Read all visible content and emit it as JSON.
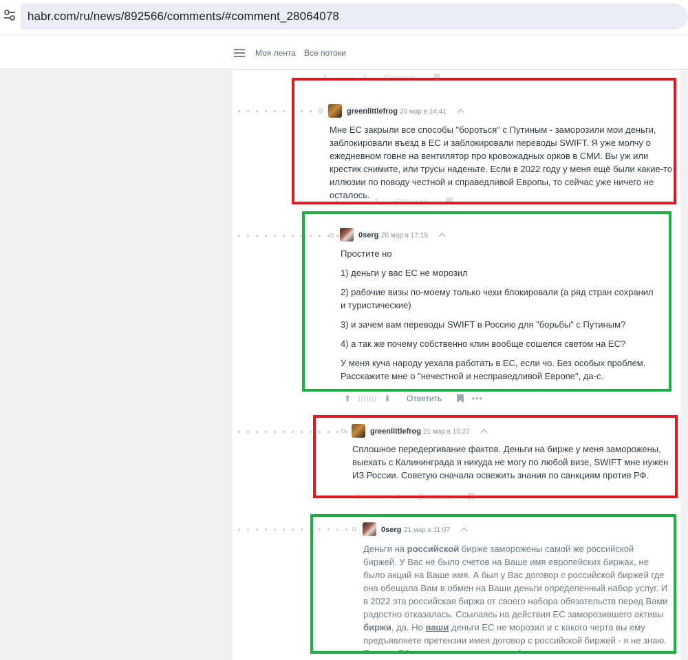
{
  "browser": {
    "url": "habr.com/ru/news/892566/comments/#comment_28064078"
  },
  "header": {
    "my_feed": "Моя лента",
    "all_streams": "Все потоки"
  },
  "actions": {
    "reply": "Ответить",
    "more": "•••"
  },
  "comments": [
    {
      "author": "greenlittlefrog",
      "date": "20 мар в 14:41",
      "paragraphs": [
        "Мне ЕС закрыли все способы \"бороться\" с Путиным - заморозили мои деньги, заблокировали въезд в ЕС и заблокировали переводы SWIFT. Я уже молчу о ежедневном говне на вентилятор про кровожадных орков в СМИ. Вы уж или крестик снимите, или трусы наденьте. Если в 2022 году у меня ещё были какие-то иллюзии по поводу честной и справедливой Европы, то сейчас уже ничего не осталось."
      ],
      "highlight": "#e11a22"
    },
    {
      "author": "0serg",
      "date": "20 мар в 17:19",
      "paragraphs": [
        "Простите но",
        "1) деньги у вас ЕС не морозил",
        "2) рабочие визы по-моему только чехи блокировали (а ряд стран сохранил и туристические)",
        "3) и зачем вам переводы SWIFT в Россию для \"борьбы\" с Путиным?",
        "4) а так же почему собственно клин вообще сошелся светом на ЕС?",
        "У меня куча народу уехала работать в ЕС, если чо. Без особых проблем. Расскажите мне о \"нечестной и несправедливой Европе\", да-с."
      ],
      "highlight": "#1cb043"
    },
    {
      "author": "greenlittlefrog",
      "date": "21 мар в 10:27",
      "paragraphs": [
        "Сплошное передергивание фактов. Деньги на бирже у меня заморожены, выехать с Калининграда я никуда не могу по любой визе, SWIFT мне нужен ИЗ России. Советую сначала освежить знания по санкциям против РФ."
      ],
      "highlight": "#e11a22"
    },
    {
      "author": "0serg",
      "date": "21 мар в 11:07",
      "parts": {
        "p1": "Деньги на ",
        "b1": "российской",
        "p2": " бирже заморожены самой же российской биржей. У Вас не было счетов на Ваше имя европейских биржах, не было акций на Ваше имя. А был у Вас договор с российской биржей где она обещала Вам в обмен на Ваши деньги определенный набор услуг. И в 2022 эта российская биржа от своего набора обязательств перед Вами радостно отказалась. Ссылаясь на действия ЕС заморозившего активы ",
        "b2": "биржи",
        "p3": ", да. Но ",
        "b3": "ваши",
        "p4": " деньги ЕС не морозил и с какого черта вы ему предъявляете претензии имея договор с российской биржей - я не знаю. Причем ЕС предлагал варианты где биржа раскрывает полную структуру"
      },
      "highlight": "#1cb043"
    }
  ]
}
